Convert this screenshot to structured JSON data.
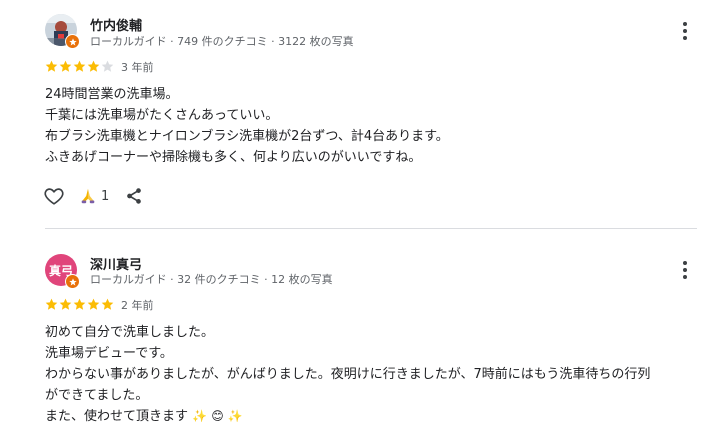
{
  "reviews": [
    {
      "name": "竹内俊輔",
      "meta": "ローカルガイド · 749 件のクチコミ · 3122 枚の写真",
      "rating": 4,
      "time": "3 年前",
      "lines": [
        "24時間営業の洗車場。",
        "千葉には洗車場がたくさんあっていい。",
        "布ブラシ洗車機とナイロンブラシ洗車機が2台ずつ、計4台あります。",
        "ふきあげコーナーや掃除機も多く、何より広いのがいいですね。"
      ],
      "thanks_count": "1",
      "avatar_icon": "photo-avatar"
    },
    {
      "name": "深川真弓",
      "avatar_text": "真弓",
      "meta": "ローカルガイド · 32 件のクチコミ · 12 枚の写真",
      "rating": 5,
      "time": "2 年前",
      "lines": [
        "初めて自分で洗車しました。",
        "洗車場デビューです。",
        "わからない事がありましたが、がんばりました。夜明けに行きましたが、7時前にはもう洗車待ちの行列",
        "ができてました。",
        "また、使わせて頂きます"
      ],
      "trailing_emojis": [
        "✨",
        "😊",
        "✨"
      ]
    }
  ],
  "colors": {
    "star_filled": "#fbbc04",
    "star_empty": "#dadce0",
    "guide_badge": "#e8710a",
    "avatar_bg": "#e0457b"
  }
}
